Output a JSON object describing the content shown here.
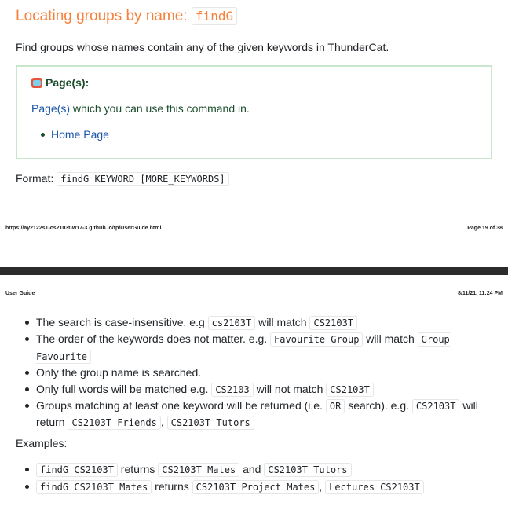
{
  "title": {
    "text": "Locating groups by name:",
    "code": "findG"
  },
  "description": "Find groups whose names contain any of the given keywords in ThunderCat.",
  "pages_box": {
    "heading": "Page(s):",
    "icon": "tv-icon",
    "text_link": "Page(s)",
    "text_rest": " which you can use this command in.",
    "items": [
      "Home Page"
    ]
  },
  "format": {
    "label": "Format:",
    "code": "findG KEYWORD [MORE_KEYWORDS]"
  },
  "footer": {
    "url": "https://ay2122s1-cs2103t-w17-3.github.io/tp/UserGuide.html",
    "page": "Page 19 of 38"
  },
  "header": {
    "title": "User Guide",
    "datetime": "8/11/21, 11:24 PM"
  },
  "notes": [
    [
      {
        "t": "The search is case-insensitive. e.g "
      },
      {
        "c": "cs2103T"
      },
      {
        "t": " will match "
      },
      {
        "c": "CS2103T"
      }
    ],
    [
      {
        "t": "The order of the keywords does not matter. e.g. "
      },
      {
        "c": "Favourite Group"
      },
      {
        "t": " will match "
      },
      {
        "c": "Group Favourite"
      }
    ],
    [
      {
        "t": "Only the group name is searched."
      }
    ],
    [
      {
        "t": "Only full words will be matched e.g. "
      },
      {
        "c": "CS2103"
      },
      {
        "t": " will not match "
      },
      {
        "c": "CS2103T"
      }
    ],
    [
      {
        "t": "Groups matching at least one keyword will be returned (i.e. "
      },
      {
        "c": "OR"
      },
      {
        "t": " search). e.g. "
      },
      {
        "c": "CS2103T"
      },
      {
        "t": " will return "
      },
      {
        "c": "CS2103T Friends"
      },
      {
        "t": ", "
      },
      {
        "c": "CS2103T Tutors"
      }
    ]
  ],
  "examples_label": "Examples:",
  "examples": [
    [
      {
        "c": "findG CS2103T"
      },
      {
        "t": " returns "
      },
      {
        "c": "CS2103T Mates"
      },
      {
        "t": " and "
      },
      {
        "c": "CS2103T Tutors"
      }
    ],
    [
      {
        "c": "findG CS2103T Mates"
      },
      {
        "t": " returns "
      },
      {
        "c": "CS2103T Project Mates"
      },
      {
        "t": ", "
      },
      {
        "c": "Lectures CS2103T"
      }
    ]
  ],
  "colors": {
    "heading": "#f7813a",
    "box_border": "#c8e6cc",
    "link": "#1a55a8"
  }
}
